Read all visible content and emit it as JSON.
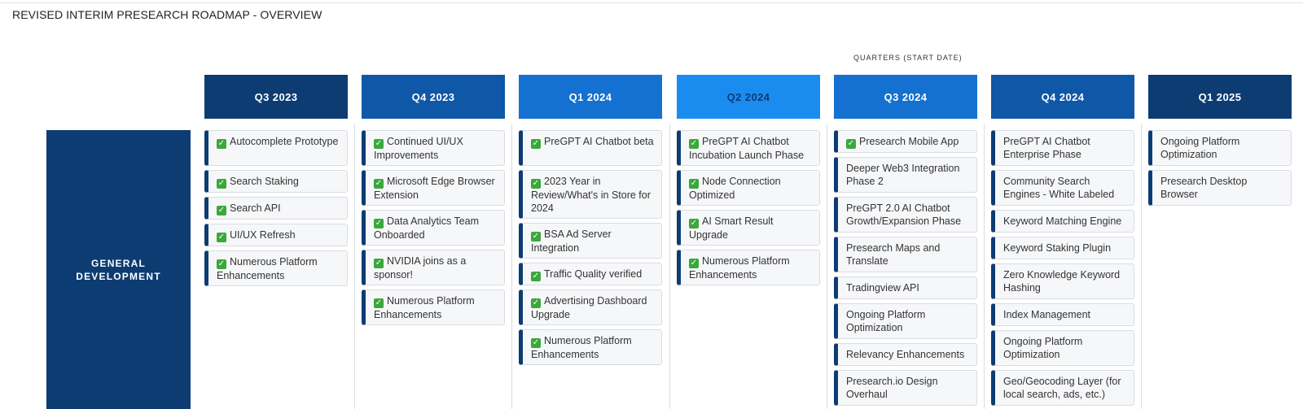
{
  "title": "REVISED INTERIM PRESEARCH ROADMAP - OVERVIEW",
  "axis_caption": "QUARTERS (START DATE)",
  "row_header": "GENERAL DEVELOPMENT",
  "colors": {
    "row_header": "#0d3c73",
    "card_accent": "#0d3c73",
    "check": "#3aa83a"
  },
  "columns": [
    {
      "label": "Q3 2023",
      "color": "#0d3c73",
      "text_color": "#ffffff",
      "items": [
        {
          "text": "Autocomplete Prototype",
          "done": true
        },
        {
          "text": "Search Staking",
          "done": true
        },
        {
          "text": "Search API",
          "done": true
        },
        {
          "text": "UI/UX Refresh",
          "done": true
        },
        {
          "text": "Numerous Platform Enhancements",
          "done": true
        }
      ]
    },
    {
      "label": "Q4 2023",
      "color": "#0f57a7",
      "text_color": "#ffffff",
      "items": [
        {
          "text": "Continued UI/UX Improvements",
          "done": true
        },
        {
          "text": "Microsoft Edge Browser Extension",
          "done": true
        },
        {
          "text": "Data Analytics Team Onboarded",
          "done": true
        },
        {
          "text": "NVIDIA joins as a sponsor!",
          "done": true
        },
        {
          "text": "Numerous Platform Enhancements",
          "done": true
        }
      ]
    },
    {
      "label": "Q1 2024",
      "color": "#1470d1",
      "text_color": "#ffffff",
      "items": [
        {
          "text": "PreGPT AI Chatbot beta",
          "done": true
        },
        {
          "text": "2023 Year in Review/What's in Store for 2024",
          "done": true
        },
        {
          "text": "BSA Ad Server Integration",
          "done": true
        },
        {
          "text": "Traffic Quality verified",
          "done": true
        },
        {
          "text": "Advertising Dashboard Upgrade",
          "done": true
        },
        {
          "text": "Numerous Platform Enhancements",
          "done": true
        }
      ]
    },
    {
      "label": "Q2 2024",
      "color": "#1a8cf0",
      "text_color": "#0d3c73",
      "items": [
        {
          "text": "PreGPT AI Chatbot Incubation Launch Phase",
          "done": true
        },
        {
          "text": "Node Connection Optimized",
          "done": true
        },
        {
          "text": "AI Smart Result Upgrade",
          "done": true
        },
        {
          "text": "Numerous Platform Enhancements",
          "done": true
        }
      ]
    },
    {
      "label": "Q3 2024",
      "color": "#1470d1",
      "text_color": "#ffffff",
      "items": [
        {
          "text": "Presearch Mobile App",
          "done": true
        },
        {
          "text": "Deeper Web3 Integration Phase 2",
          "done": false
        },
        {
          "text": "PreGPT 2.0 AI Chatbot Growth/Expansion Phase",
          "done": false
        },
        {
          "text": "Presearch Maps and Translate",
          "done": false
        },
        {
          "text": "Tradingview API",
          "done": false
        },
        {
          "text": "Ongoing Platform Optimization",
          "done": false
        },
        {
          "text": "Relevancy Enhancements",
          "done": false
        },
        {
          "text": "Presearch.io Design Overhaul",
          "done": false
        }
      ]
    },
    {
      "label": "Q4 2024",
      "color": "#0f57a7",
      "text_color": "#ffffff",
      "items": [
        {
          "text": "PreGPT AI Chatbot Enterprise Phase",
          "done": false
        },
        {
          "text": "Community Search Engines - White Labeled",
          "done": false
        },
        {
          "text": "Keyword Matching Engine",
          "done": false
        },
        {
          "text": "Keyword Staking Plugin",
          "done": false
        },
        {
          "text": "Zero Knowledge Keyword Hashing",
          "done": false
        },
        {
          "text": "Index Management",
          "done": false
        },
        {
          "text": "Ongoing Platform Optimization",
          "done": false
        },
        {
          "text": "Geo/Geocoding Layer (for local search, ads, etc.)",
          "done": false
        }
      ]
    },
    {
      "label": "Q1 2025",
      "color": "#0d3c73",
      "text_color": "#ffffff",
      "items": [
        {
          "text": "Ongoing Platform Optimization",
          "done": false
        },
        {
          "text": "Presearch Desktop Browser",
          "done": false
        }
      ]
    }
  ]
}
